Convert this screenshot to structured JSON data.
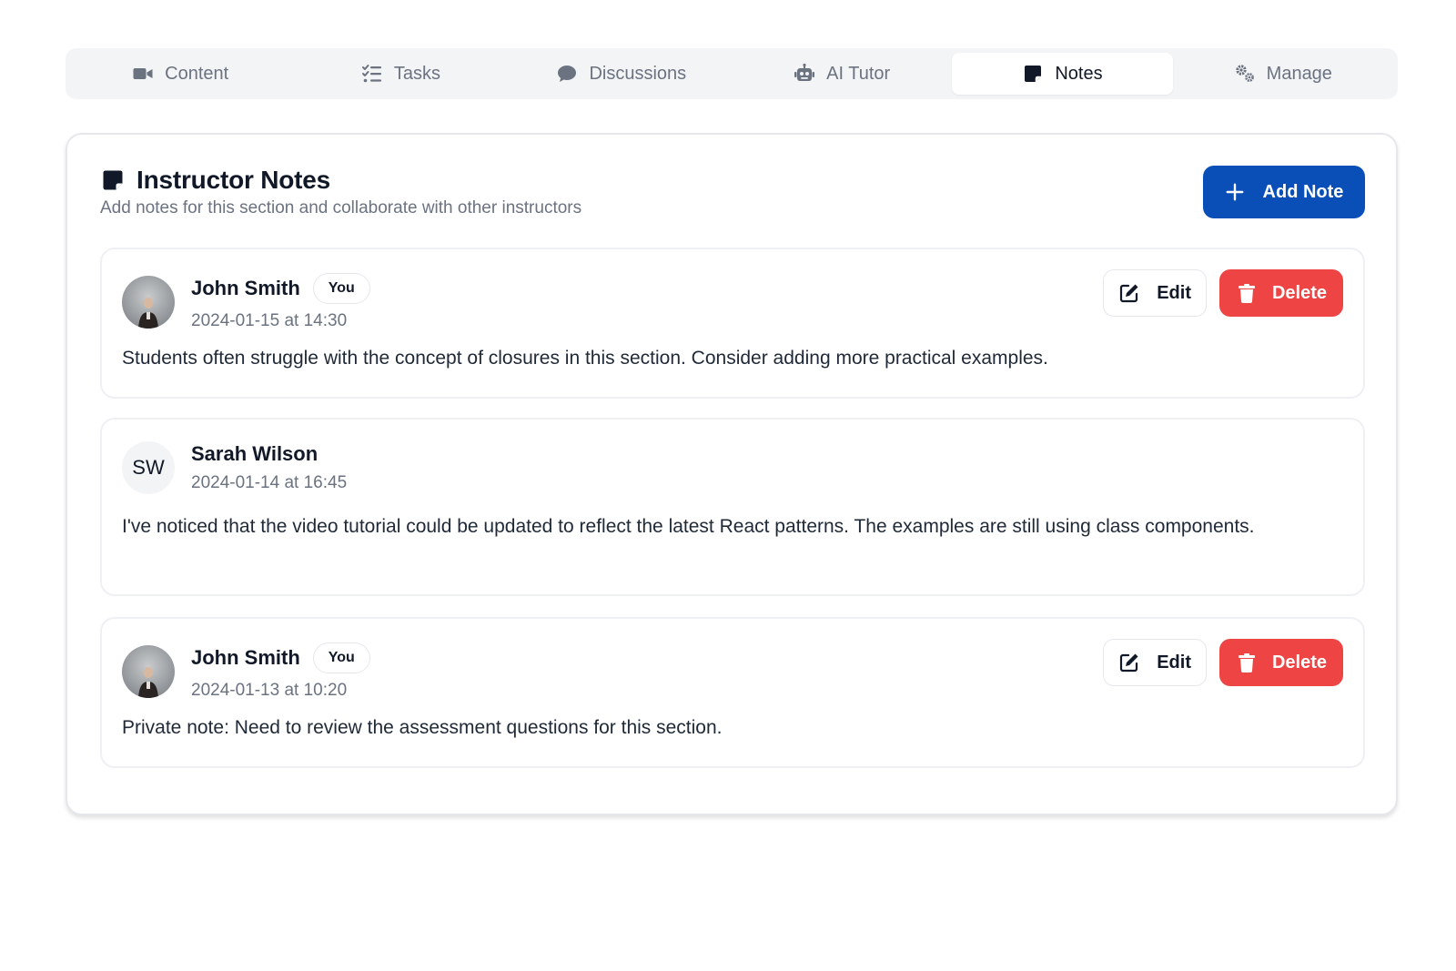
{
  "tabs": [
    {
      "label": "Content",
      "icon": "video-icon",
      "active": false
    },
    {
      "label": "Tasks",
      "icon": "list-check-icon",
      "active": false
    },
    {
      "label": "Discussions",
      "icon": "chat-bubble-icon",
      "active": false
    },
    {
      "label": "AI Tutor",
      "icon": "robot-icon",
      "active": false
    },
    {
      "label": "Notes",
      "icon": "sticky-note-icon",
      "active": true
    },
    {
      "label": "Manage",
      "icon": "gears-icon",
      "active": false
    }
  ],
  "card": {
    "title": "Instructor Notes",
    "subtitle": "Add notes for this section and collaborate with other instructors",
    "add_note_label": "Add Note"
  },
  "notes": [
    {
      "author": "John Smith",
      "badge": "You",
      "date": "2024-01-15 at 14:30",
      "text": "Students often struggle with the concept of closures in this section. Consider adding more practical examples.",
      "edit_label": "Edit",
      "delete_label": "Delete"
    },
    {
      "author": "Sarah Wilson",
      "initials": "SW",
      "date": "2024-01-14 at 16:45",
      "text": "I've noticed that the video tutorial could be updated to reflect the latest React patterns. The examples are still using class components."
    },
    {
      "author": "John Smith",
      "badge": "You",
      "date": "2024-01-13 at 10:20",
      "text": "Private note: Need to review the assessment questions for this section.",
      "edit_label": "Edit",
      "delete_label": "Delete"
    }
  ],
  "colors": {
    "primary": "#0a4fb8",
    "danger": "#ef4444",
    "tab_bg": "#f3f4f6",
    "muted_text": "#6b7280"
  }
}
